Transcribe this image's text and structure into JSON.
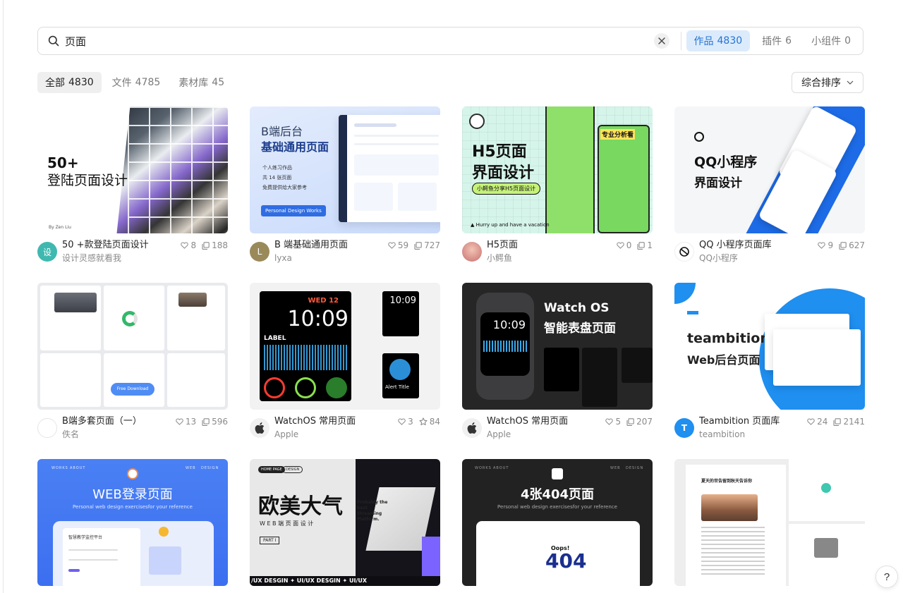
{
  "search": {
    "value": "页面",
    "placeholder": ""
  },
  "type_tabs": [
    {
      "label": "作品",
      "count": "4830"
    },
    {
      "label": "插件",
      "count": "6"
    },
    {
      "label": "小组件",
      "count": "0"
    }
  ],
  "filters": [
    {
      "label": "全部",
      "count": "4830"
    },
    {
      "label": "文件",
      "count": "4785"
    },
    {
      "label": "素材库",
      "count": "45"
    }
  ],
  "sort": {
    "label": "综合排序"
  },
  "cards": [
    {
      "title": "50 +款登陆页面设计",
      "author": "设计灵感就看我",
      "likes": "8",
      "copies": "188",
      "avatar_text": "设",
      "avatar_color": "#3fb9b0",
      "thumb": {
        "line1": "50+",
        "line2": "登陆页面设计",
        "foot": "By Zen Liu"
      }
    },
    {
      "title": "B 端基础通用页面",
      "author": "lyxa",
      "likes": "59",
      "copies": "727",
      "avatar_text": "L",
      "avatar_color": "#9a8a5a",
      "thumb": {
        "line1": "B端后台",
        "line2": "基础通用页面",
        "bullets": [
          "个人练习作品",
          "共 14 张页面",
          "免费提供给大家参考"
        ],
        "button": "Personal Design Works"
      }
    },
    {
      "title": "H5页面",
      "author": "小鳄鱼",
      "likes": "0",
      "copies": "1",
      "avatar_text": "",
      "avatar_color": "#d98c8c",
      "thumb": {
        "line1": "H5页面",
        "line2": "界面设计",
        "tag": "小鳄鱼分享H5页面设计",
        "side": "专业分析看",
        "foot": "▲ Hurry up and have a vacation"
      }
    },
    {
      "title": "QQ 小程序页面库",
      "author": "QQ小程序",
      "likes": "9",
      "copies": "627",
      "avatar_text": "",
      "avatar_color": "#ffffff",
      "thumb": {
        "line1": "QQ小程序",
        "line2": "界面设计"
      }
    },
    {
      "title": "B端多套页面（一）",
      "author": "佚名",
      "likes": "13",
      "copies": "596",
      "avatar_text": "",
      "avatar_color": "#ffffff",
      "thumb": {
        "button": "Free Download"
      }
    },
    {
      "title": "WatchOS 常用页面",
      "author": "Apple",
      "likes": "3",
      "copies": "84",
      "copy_kind": "star",
      "avatar_text": "",
      "avatar_color": "#f0f0f0",
      "thumb": {
        "day": "WED 12",
        "time": "10:09",
        "label": "LABEL",
        "small_time": "10:09",
        "small_label": "Alert Title"
      }
    },
    {
      "title": "WatchOS 常用页面",
      "author": "Apple",
      "likes": "5",
      "copies": "207",
      "avatar_text": "",
      "avatar_color": "#f0f0f0",
      "thumb": {
        "line1": "Watch OS",
        "line2": "智能表盘页面",
        "time": "10:09"
      }
    },
    {
      "title": "Teambition 页面库",
      "author": "teambition",
      "likes": "24",
      "copies": "2141",
      "avatar_text": "T",
      "avatar_color": "#1f8ff0",
      "thumb": {
        "line1": "teambition",
        "line2": "Web后台页面"
      }
    },
    {
      "title": "",
      "author": "",
      "likes": "",
      "copies": "",
      "thumb": {
        "nav": [
          "WORKS",
          "ABOUT",
          "WEB",
          "DESIGN"
        ],
        "line1": "WEB登录页面",
        "sub": "Personal web design exercisesfor your reference",
        "panel": "智慧教学监控平台"
      }
    },
    {
      "title": "",
      "author": "",
      "likes": "",
      "copies": "",
      "thumb": {
        "tags": [
          "HOME PAGE",
          "DESIGN"
        ],
        "line1": "欧美大气",
        "line2": "W E B 端 页 面 设 计",
        "part": "PART I",
        "marquee": "/UX  DESGIN ✦ UI/UX  DESGIN ✦ UI/UX",
        "quote": "Probably the best Streaming Platform."
      }
    },
    {
      "title": "",
      "author": "",
      "likes": "",
      "copies": "",
      "thumb": {
        "nav": [
          "WORKS",
          "ABOUT",
          "WEB",
          "DESIGN"
        ],
        "line1": "4张404页面",
        "sub": "Personal web design exercisesfor your reference",
        "oops": "Oops!",
        "big": "404"
      }
    },
    {
      "title": "",
      "author": "",
      "likes": "",
      "copies": "",
      "thumb": {
        "heading": "夏天的世告留到秋天告诉你"
      }
    }
  ],
  "help": "?"
}
